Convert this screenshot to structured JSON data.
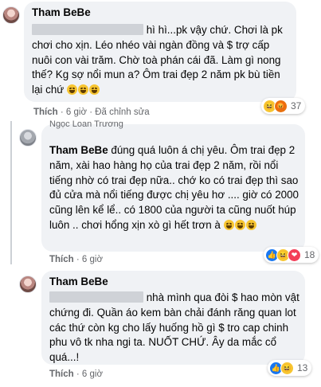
{
  "comments": [
    {
      "author": "Tham BeBe",
      "text": "hì hì...pk vậy chứ. Chơi là pk chơi cho xịn. Léo nhéo vài ngàn đồng và $ trợ cấp nuôi con vài trăm. Chờ toà phán cái đã. Làm gì nong thế? Kg sợ nổi mun a? Ôm trai đẹp 2 năm pk bù tiền lại chứ",
      "like_label": "Thích",
      "time": "6 giờ",
      "edited": "Đã chỉnh sửa",
      "reaction_icons": [
        "haha-icon",
        "angry-icon"
      ],
      "reaction_count": "37",
      "trailing_emojis": [
        "rofl-emoji",
        "rofl-emoji",
        "rofl-emoji"
      ]
    },
    {
      "quoted_name": "Ngọc Loan Trương",
      "author": "Tham BeBe",
      "text": "đúng quá luôn á chị yêu. Ôm trai đẹp 2 năm, xài hao hàng họ của trai đẹp 2 năm, rồi nổi tiếng nhờ có trai đẹp nữa.. chớ ko có trai đẹp thì sao đủ cửa mà nổi tiếng được chị yêu hơ .... giờ có 2000 cũng lên kể lể.. có 1800 của người ta cũng nuốt húp luôn .. chơi hổng xịn xò gì hết trơn à",
      "like_label": "Thích",
      "time": "6 giờ",
      "reaction_icons": [
        "like-icon",
        "haha-icon",
        "love-icon"
      ],
      "reaction_count": "18",
      "trailing_emojis": [
        "rofl-emoji",
        "rofl-emoji",
        "rofl-emoji"
      ]
    },
    {
      "author": "Tham BeBe",
      "text": "nhà mình qua đòi $ hao mòn vật chứng đi. Quần áo kem bàn chải đánh răng quan lot các thứ còn kg cho lấy huống hồ gì $ tro cap chinh phu vô tk nha ngi ta. NUỐT CHỨ. Ây da mắc cổ quá...!",
      "like_label": "Thích",
      "time": "6 giờ",
      "reaction_icons": [
        "like-icon",
        "haha-icon"
      ],
      "reaction_count": "13"
    }
  ],
  "colors": {
    "bubble": "#f0f2f5",
    "meta_text": "#65676b",
    "haha": "#f7c531",
    "angry": "#e9710f",
    "like": "#1877f2",
    "love": "#f33e58"
  }
}
